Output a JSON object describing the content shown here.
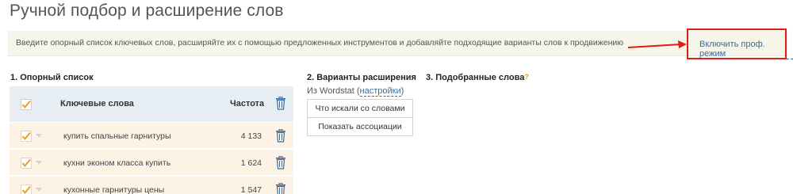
{
  "page": {
    "title": "Ручной подбор и расширение слов"
  },
  "info_bar": {
    "text": "Введите опорный список ключевых слов, расширяйте их с помощью предложенных инструментов и добавляйте подходящие варианты слов к продвижению",
    "pro_mode_link": "Включить проф. режим",
    "highlight_color": "#e21b1b"
  },
  "section1": {
    "heading": "1. Опорный список",
    "table": {
      "col_keywords": "Ключевые слова",
      "col_frequency": "Частота",
      "rows": [
        {
          "keyword": "купить спальные гарнитуры",
          "frequency": "4 133",
          "checked": true
        },
        {
          "keyword": "кухни эконом класса купить",
          "frequency": "1 624",
          "checked": true
        },
        {
          "keyword": "кухонные гарнитуры цены",
          "frequency": "1 547",
          "checked": true
        }
      ]
    }
  },
  "section2": {
    "heading": "2. Варианты расширения",
    "source_prefix": "Из Wordstat (",
    "source_link": "настройки",
    "source_suffix": ")",
    "button_searched_with": "Что искали со словами",
    "button_associations": "Показать ассоциации"
  },
  "section3": {
    "heading": "3. Подобранные слова",
    "help_mark": "?"
  },
  "colors": {
    "accent_check": "#e8a020",
    "link": "#3a6f9a",
    "table_header_bg": "#e7eef3",
    "row_bg": "#fdf2e6",
    "info_bg": "#f6f5e9"
  }
}
